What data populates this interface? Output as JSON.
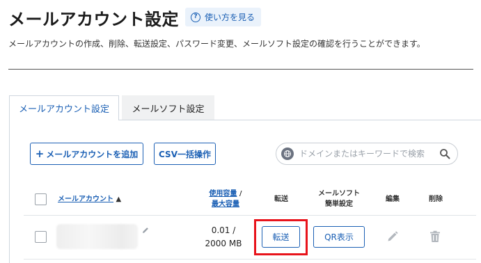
{
  "page": {
    "title": "メールアカウント設定",
    "howto_label": "使い方を見る",
    "description": "メールアカウントの作成、削除、転送設定、パスワード変更、メールソフト設定の確認を行うことができます。"
  },
  "tabs": [
    {
      "label": "メールアカウント設定",
      "active": true
    },
    {
      "label": "メールソフト設定",
      "active": false
    }
  ],
  "toolbar": {
    "add_label": "メールアカウントを追加",
    "csv_label": "CSV一括操作",
    "search_placeholder": "ドメインまたはキーワードで検索"
  },
  "table": {
    "headers": {
      "account": "メールアカウント",
      "sort_indicator": "▲",
      "usage_line1": "使用容量",
      "usage_sep": " /",
      "usage_line2": "最大容量",
      "forward": "転送",
      "mailsoft_line1": "メールソフト",
      "mailsoft_line2": "簡単設定",
      "edit": "編集",
      "delete": "削除"
    },
    "rows": [
      {
        "usage_line1": "0.01 /",
        "usage_line2": "2000 MB",
        "forward_button": "転送",
        "qr_button": "QR表示"
      }
    ]
  },
  "colors": {
    "accent": "#1a5fb4",
    "highlight_border": "#e8131b",
    "tab_inactive_bg": "#f0f1f2",
    "howto_bg": "#eaf2fb"
  },
  "icons": {
    "howto": "question-circle-icon",
    "add": "plus-icon",
    "search_scope": "globe-icon",
    "search": "magnifier-icon",
    "row_edit_name": "pencil-icon",
    "edit": "pencil-icon",
    "delete": "trash-icon"
  }
}
